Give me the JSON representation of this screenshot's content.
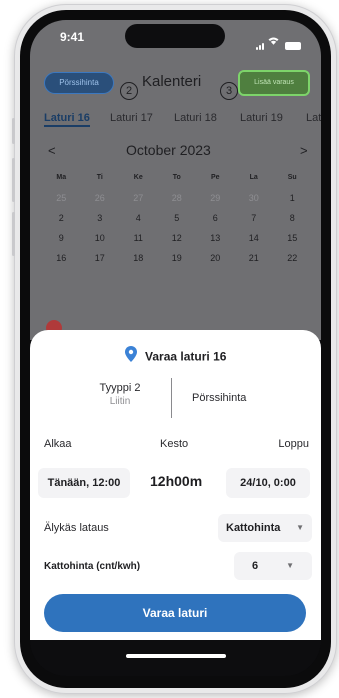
{
  "status_bar": {
    "time": "9:41"
  },
  "header": {
    "left_button": "Pörssihinta",
    "title": "Kalenteri",
    "right_button": "Lisää varaus",
    "marker_2": "2",
    "marker_3": "3"
  },
  "tabs": [
    "Laturi 16",
    "Laturi 17",
    "Laturi 18",
    "Laturi 19",
    "Lat"
  ],
  "calendar": {
    "prev": "<",
    "next": ">",
    "month": "October 2023",
    "weekdays": [
      "Ma",
      "Ti",
      "Ke",
      "To",
      "Pe",
      "La",
      "Su"
    ],
    "weeks": [
      [
        "25",
        "26",
        "27",
        "28",
        "29",
        "30",
        "1"
      ],
      [
        "2",
        "3",
        "4",
        "5",
        "6",
        "7",
        "8"
      ],
      [
        "9",
        "10",
        "11",
        "12",
        "13",
        "14",
        "15"
      ],
      [
        "16",
        "17",
        "18",
        "19",
        "20",
        "21",
        "22"
      ]
    ]
  },
  "sheet": {
    "title": "Varaa laturi 16",
    "type_main": "Tyyppi 2",
    "type_sub": "Liitin",
    "price_type": "Pörssihinta",
    "label_start": "Alkaa",
    "label_duration": "Kesto",
    "label_end": "Loppu",
    "start_value": "Tänään, 12:00",
    "duration_value": "12h00m",
    "end_value": "24/10, 0:00",
    "smart_label": "Älykäs lataus",
    "smart_value": "Kattohinta",
    "cap_label": "Kattohinta (cnt/kwh)",
    "cap_value": "6",
    "book_button": "Varaa laturi"
  },
  "colors": {
    "primary": "#2f73bd",
    "accent_green": "#7dd46a",
    "dim_background": "#6f6f72"
  }
}
